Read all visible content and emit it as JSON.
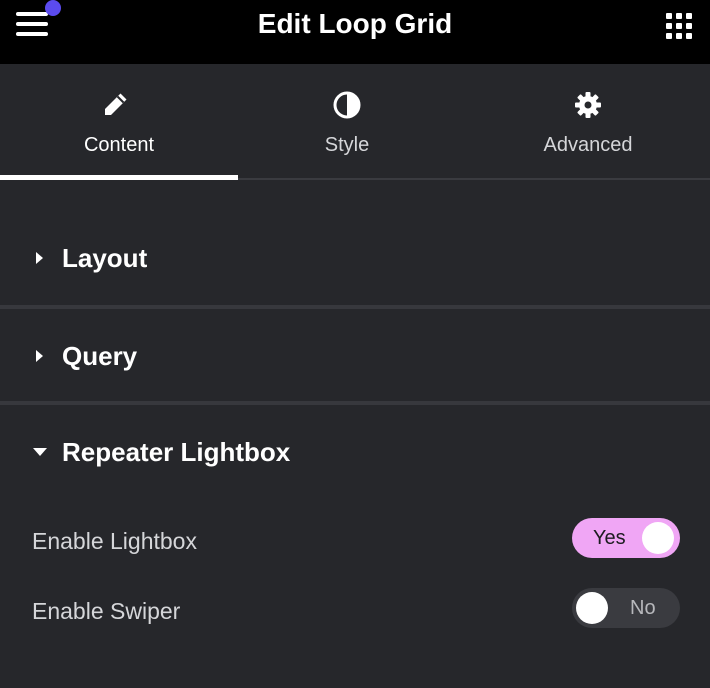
{
  "header": {
    "title": "Edit Loop Grid",
    "menu_icon": "hamburger-menu-icon",
    "notification_dot_color": "#5b4bee",
    "apps_icon": "apps-grid-icon"
  },
  "tabs": [
    {
      "label": "Content",
      "icon": "pencil-icon",
      "active": true
    },
    {
      "label": "Style",
      "icon": "half-circle-contrast-icon",
      "active": false
    },
    {
      "label": "Advanced",
      "icon": "gear-icon",
      "active": false
    }
  ],
  "sections": [
    {
      "title": "Layout",
      "expanded": false
    },
    {
      "title": "Query",
      "expanded": false
    },
    {
      "title": "Repeater Lightbox",
      "expanded": true
    }
  ],
  "controls": [
    {
      "label": "Enable Lightbox",
      "state": "Yes",
      "on": true
    },
    {
      "label": "Enable Swiper",
      "state": "No",
      "on": false
    }
  ],
  "colors": {
    "accent_toggle_on": "#f0a6f5",
    "panel_background": "#26272b",
    "header_background": "#000000"
  }
}
